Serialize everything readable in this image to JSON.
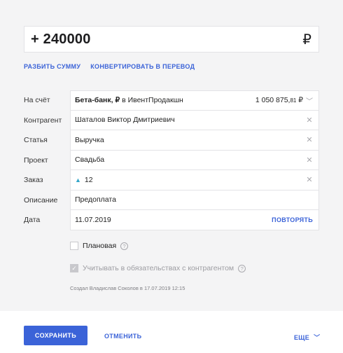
{
  "amount": {
    "value": "+ 240000",
    "currency": "₽"
  },
  "links": {
    "split": "РАЗБИТЬ СУММУ",
    "convert": "КОНВЕРТИРОВАТЬ В ПЕРЕВОД"
  },
  "form": {
    "account": {
      "label": "На счёт",
      "bank": "Бета-банк, ₽",
      "org": " в ИвентПродакшн",
      "balance_main": "1 050 875,",
      "balance_cents": "81",
      "balance_currency": " ₽"
    },
    "counterparty": {
      "label": "Контрагент",
      "value": "Шаталов Виктор Дмитриевич"
    },
    "article": {
      "label": "Статья",
      "value": "Выручка"
    },
    "project": {
      "label": "Проект",
      "value": "Свадьба"
    },
    "order": {
      "label": "Заказ",
      "value": "12"
    },
    "description": {
      "label": "Описание",
      "value": "Предоплата"
    },
    "date": {
      "label": "Дата",
      "value": "11.07.2019",
      "repeat": "ПОВТОРЯТЬ"
    }
  },
  "options": {
    "planned": "Плановая",
    "obligations": "Учитывать в обязательствах с контрагентом"
  },
  "created_by": "Создал Владислав Соколов в 17.07.2019 12:15",
  "footer": {
    "save": "СОХРАНИТЬ",
    "cancel": "ОТМЕНИТЬ",
    "more": "ЕЩЕ"
  },
  "colors": {
    "accent": "#3b63d8",
    "order_icon": "#34a6c9"
  }
}
